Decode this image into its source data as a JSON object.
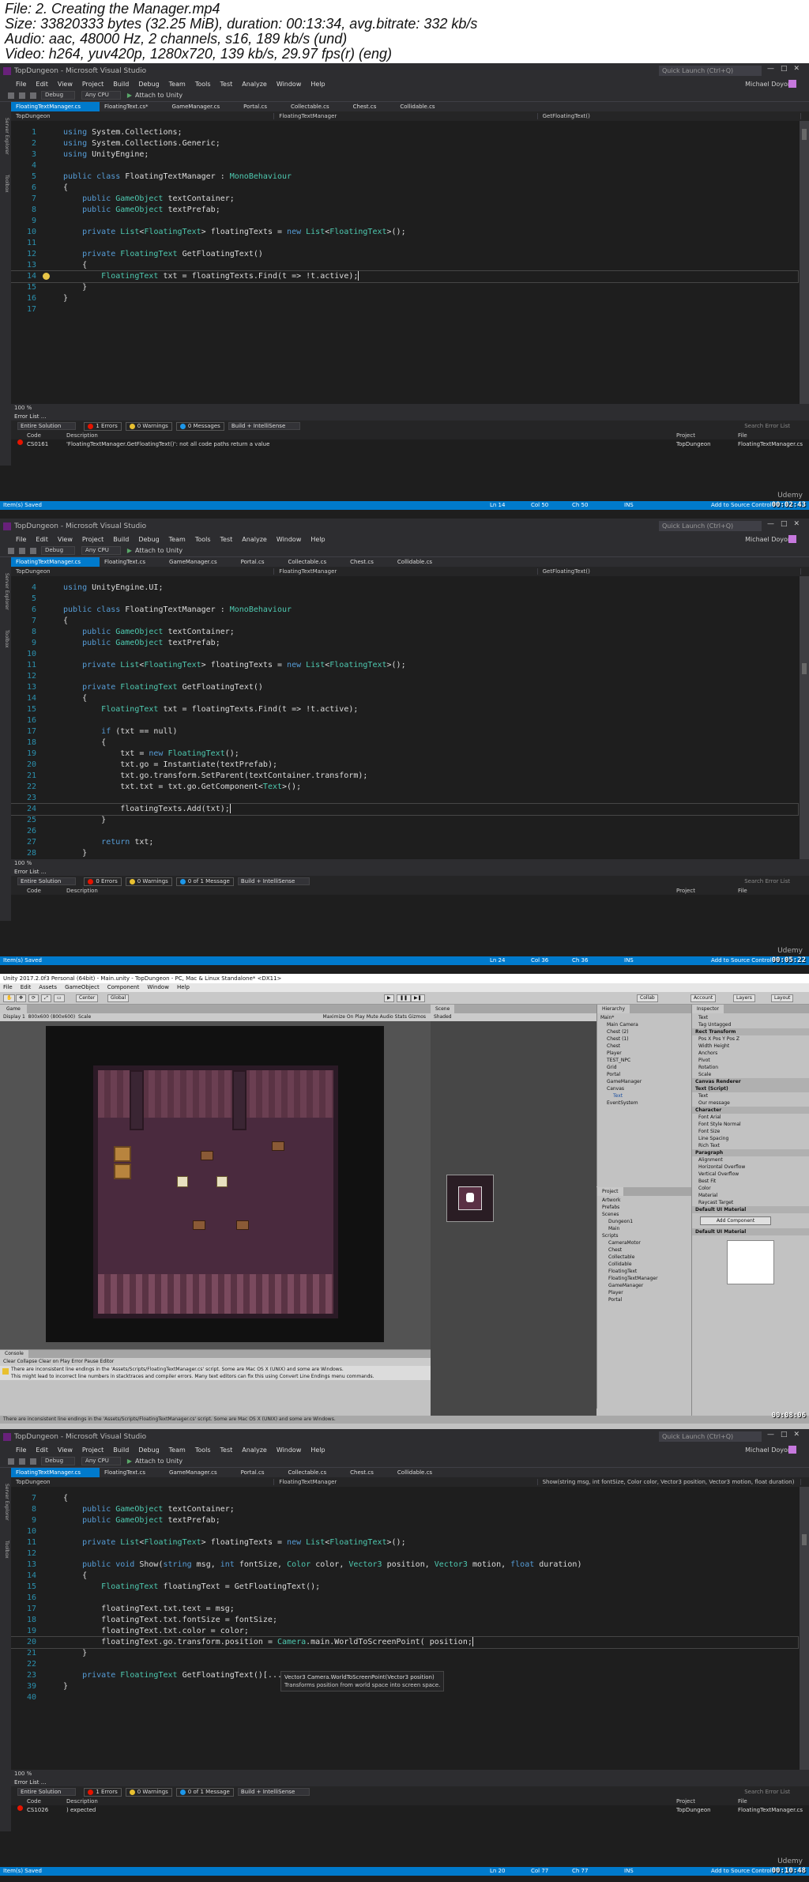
{
  "header": {
    "file_line": "File: 2. Creating the Manager.mp4",
    "size_line": "Size: 33820333 bytes (32.25 MiB), duration: 00:13:34, avg.bitrate: 332 kb/s",
    "audio_line": "Audio: aac, 48000 Hz, 2 channels, s16, 189 kb/s (und)",
    "video_line": "Video: h264, yuv420p, 1280x720, 139 kb/s, 29.97 fps(r) (eng)"
  },
  "vs_common": {
    "window_title": "TopDungeon - Microsoft Visual Studio",
    "quick_launch": "Quick Launch (Ctrl+Q)",
    "user_name": "Michael Doyon",
    "menu": [
      "File",
      "Edit",
      "View",
      "Project",
      "Build",
      "Debug",
      "Team",
      "Tools",
      "Test",
      "Analyze",
      "Window",
      "Help"
    ],
    "toolbar": {
      "config": "Debug",
      "platform": "Any CPU",
      "attach": "Attach to Unity"
    },
    "side_tabs": [
      "Server Explorer",
      "Toolbox"
    ],
    "error_list_title": "Error List ...",
    "scope": "Entire Solution",
    "build_filter": "Build + IntelliSense",
    "search_placeholder": "Search Error List",
    "columns": {
      "code": "Code",
      "description": "Description",
      "project": "Project",
      "file": "File"
    },
    "status_saved": "Item(s) Saved",
    "status_ins": "INS",
    "publish": "Add to Source Control",
    "watermark": "Udemy"
  },
  "frame1": {
    "tabs": [
      "FloatingTextManager.cs",
      "FloatingText.cs*",
      "GameManager.cs",
      "Portal.cs",
      "Collectable.cs",
      "Chest.cs",
      "Collidable.cs"
    ],
    "nav": [
      "TopDungeon",
      "FloatingTextManager",
      "GetFloatingText()"
    ],
    "code": [
      {
        "n": "1",
        "text": "using System.Collections;"
      },
      {
        "n": "2",
        "text": "using System.Collections.Generic;"
      },
      {
        "n": "3",
        "text": "using UnityEngine;"
      },
      {
        "n": "4",
        "text": ""
      },
      {
        "n": "5",
        "text": "public class FloatingTextManager : MonoBehaviour"
      },
      {
        "n": "6",
        "text": "{"
      },
      {
        "n": "7",
        "text": "    public GameObject textContainer;"
      },
      {
        "n": "8",
        "text": "    public GameObject textPrefab;"
      },
      {
        "n": "9",
        "text": ""
      },
      {
        "n": "10",
        "text": "    private List<FloatingText> floatingTexts = new List<FloatingText>();"
      },
      {
        "n": "11",
        "text": ""
      },
      {
        "n": "12",
        "text": "    private FloatingText GetFloatingText()"
      },
      {
        "n": "13",
        "text": "    {"
      },
      {
        "n": "14",
        "text": "        FloatingText txt = floatingTexts.Find(t => !t.active);"
      },
      {
        "n": "15",
        "text": "    }"
      },
      {
        "n": "16",
        "text": "}"
      },
      {
        "n": "17",
        "text": ""
      }
    ],
    "zoom": "100 %",
    "errors": "1 Errors",
    "warnings": "0 Warnings",
    "messages": "0 Messages",
    "error_row": {
      "code": "CS0161",
      "description": "'FloatingTextManager.GetFloatingText()': not all code paths return a value",
      "project": "TopDungeon",
      "file": "FloatingTextManager.cs"
    },
    "status": {
      "ln": "Ln 14",
      "col": "Col 50",
      "ch": "Ch 50"
    },
    "timestamp": "00:02:43"
  },
  "frame2": {
    "tabs": [
      "FloatingTextManager.cs",
      "FloatingText.cs",
      "GameManager.cs",
      "Portal.cs",
      "Collectable.cs",
      "Chest.cs",
      "Collidable.cs"
    ],
    "nav": [
      "TopDungeon",
      "FloatingTextManager",
      "GetFloatingText()"
    ],
    "code": [
      {
        "n": "4",
        "text": "using UnityEngine.UI;"
      },
      {
        "n": "5",
        "text": ""
      },
      {
        "n": "6",
        "text": "public class FloatingTextManager : MonoBehaviour"
      },
      {
        "n": "7",
        "text": "{"
      },
      {
        "n": "8",
        "text": "    public GameObject textContainer;"
      },
      {
        "n": "9",
        "text": "    public GameObject textPrefab;"
      },
      {
        "n": "10",
        "text": ""
      },
      {
        "n": "11",
        "text": "    private List<FloatingText> floatingTexts = new List<FloatingText>();"
      },
      {
        "n": "12",
        "text": ""
      },
      {
        "n": "13",
        "text": "    private FloatingText GetFloatingText()"
      },
      {
        "n": "14",
        "text": "    {"
      },
      {
        "n": "15",
        "text": "        FloatingText txt = floatingTexts.Find(t => !t.active);"
      },
      {
        "n": "16",
        "text": ""
      },
      {
        "n": "17",
        "text": "        if (txt == null)"
      },
      {
        "n": "18",
        "text": "        {"
      },
      {
        "n": "19",
        "text": "            txt = new FloatingText();"
      },
      {
        "n": "20",
        "text": "            txt.go = Instantiate(textPrefab);"
      },
      {
        "n": "21",
        "text": "            txt.go.transform.SetParent(textContainer.transform);"
      },
      {
        "n": "22",
        "text": "            txt.txt = txt.go.GetComponent<Text>();"
      },
      {
        "n": "23",
        "text": ""
      },
      {
        "n": "24",
        "text": "            floatingTexts.Add(txt);"
      },
      {
        "n": "25",
        "text": "        }"
      },
      {
        "n": "26",
        "text": ""
      },
      {
        "n": "27",
        "text": "        return txt;"
      },
      {
        "n": "28",
        "text": "    }"
      },
      {
        "n": "29",
        "text": "}"
      }
    ],
    "zoom": "100 %",
    "errors": "0 Errors",
    "warnings": "0 Warnings",
    "messages": "0 of 1 Message",
    "status": {
      "ln": "Ln 24",
      "col": "Col 36",
      "ch": "Ch 36"
    },
    "timestamp": "00:05:22"
  },
  "frame3": {
    "title": "Unity 2017.2.0f3 Personal (64bit) - Main.unity - TopDungeon - PC, Mac & Linux Standalone* <DX11>",
    "menu": [
      "File",
      "Edit",
      "Assets",
      "GameObject",
      "Component",
      "Window",
      "Help"
    ],
    "toolbar": {
      "center": "Center",
      "global": "Global",
      "collab": "Collab",
      "account": "Account",
      "layers": "Layers",
      "layout": "Layout"
    },
    "game_tab": "Game",
    "game_bar": {
      "display": "Display 1",
      "res": "800x600 (800x600)",
      "scale": "Scale",
      "maximize": "Maximize On Play",
      "mute": "Mute Audio",
      "stats": "Stats",
      "gizmos": "Gizmos"
    },
    "scene_tab": "Scene",
    "scene_shading": "Shaded",
    "hierarchy_tab": "Hierarchy",
    "hierarchy": [
      "Main*",
      "Main Camera",
      "Chest (2)",
      "Chest (1)",
      "Chest",
      "Player",
      "TEST_NPC",
      "Grid",
      "Portal",
      "GameManager",
      "Canvas",
      "Text",
      "EventSystem"
    ],
    "project_tab": "Project",
    "project": [
      "Artwork",
      "Prefabs",
      "Scenes",
      "Dungeon1",
      "Main",
      "Scripts",
      "CameraMotor",
      "Chest",
      "Collectable",
      "Collidable",
      "FloatingText",
      "FloatingTextManager",
      "GameManager",
      "Player",
      "Portal"
    ],
    "inspector_tab": "Inspector",
    "inspector": [
      "Text",
      "Tag Untagged",
      "Rect Transform",
      "Pos X  Pos Y  Pos Z",
      "Width  Height",
      "Anchors",
      "Pivot",
      "Rotation",
      "Scale",
      "Canvas Renderer",
      "Text (Script)",
      "Text",
      "Our message",
      "Character",
      "Font  Arial",
      "Font Style  Normal",
      "Font Size",
      "Line Spacing",
      "Rich Text",
      "Paragraph",
      "Alignment",
      "Horizontal Overflow",
      "Vertical Overflow",
      "Best Fit",
      "Color",
      "Material",
      "Raycast Target",
      "Default UI Material"
    ],
    "add_component": "Add Component",
    "preview_tab": "Default UI Material",
    "console_tab": "Console",
    "console_bar": "Clear  Collapse  Clear on Play  Error Pause  Editor",
    "console_msg": "There are inconsistent line endings in the 'Assets/Scripts/FloatingTextManager.cs' script. Some are Mac OS X (UNIX) and some are Windows.",
    "console_msg2": "This might lead to incorrect line numbers in stacktraces and compiler errors. Many text editors can fix this using Convert Line Endings menu commands.",
    "status": "There are inconsistent line endings in the 'Assets/Scripts/FloatingTextManager.cs' script. Some are Mac OS X (UNIX) and some are Windows.",
    "timestamp": "00:08:06"
  },
  "frame4": {
    "tabs": [
      "FloatingTextManager.cs",
      "FloatingText.cs",
      "GameManager.cs",
      "Portal.cs",
      "Collectable.cs",
      "Chest.cs",
      "Collidable.cs"
    ],
    "nav": [
      "TopDungeon",
      "FloatingTextManager",
      "Show(string msg, int fontSize, Color color, Vector3 position, Vector3 motion, float duration)"
    ],
    "code": [
      {
        "n": "7",
        "text": "{"
      },
      {
        "n": "8",
        "text": "    public GameObject textContainer;"
      },
      {
        "n": "9",
        "text": "    public GameObject textPrefab;"
      },
      {
        "n": "10",
        "text": ""
      },
      {
        "n": "11",
        "text": "    private List<FloatingText> floatingTexts = new List<FloatingText>();"
      },
      {
        "n": "12",
        "text": ""
      },
      {
        "n": "13",
        "text": "    public void Show(string msg, int fontSize, Color color, Vector3 position, Vector3 motion, float duration)"
      },
      {
        "n": "14",
        "text": "    {"
      },
      {
        "n": "15",
        "text": "        FloatingText floatingText = GetFloatingText();"
      },
      {
        "n": "16",
        "text": ""
      },
      {
        "n": "17",
        "text": "        floatingText.txt.text = msg;"
      },
      {
        "n": "18",
        "text": "        floatingText.txt.fontSize = fontSize;"
      },
      {
        "n": "19",
        "text": "        floatingText.txt.color = color;"
      },
      {
        "n": "20",
        "text": "        floatingText.go.transform.position = Camera.main.WorldToScreenPoint( position;"
      },
      {
        "n": "21",
        "text": "    }"
      },
      {
        "n": "22",
        "text": ""
      },
      {
        "n": "23",
        "text": "    private FloatingText GetFloatingText()[...]"
      },
      {
        "n": "39",
        "text": "}"
      },
      {
        "n": "40",
        "text": ""
      }
    ],
    "tooltip_sig": "Vector3 Camera.WorldToScreenPoint(Vector3 position)",
    "tooltip_desc": "Transforms position from world space into screen space.",
    "zoom": "100 %",
    "errors": "1 Errors",
    "warnings": "0 Warnings",
    "messages": "0 of 1 Message",
    "error_row": {
      "code": "CS1026",
      "description": ") expected",
      "project": "TopDungeon",
      "file": "FloatingTextManager.cs"
    },
    "status": {
      "ln": "Ln 20",
      "col": "Col 77",
      "ch": "Ch 77"
    },
    "timestamp": "00:10:48"
  },
  "colors": {
    "vs_accent": "#007acc",
    "vs_bg": "#1e1e1e",
    "keyword": "#569cd6",
    "type": "#4ec9b0",
    "error": "#e51400"
  }
}
